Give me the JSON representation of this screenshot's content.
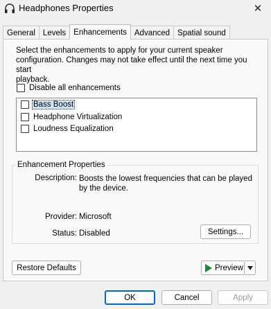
{
  "window": {
    "title": "Headphones Properties",
    "close_glyph": "✕"
  },
  "tabs": [
    {
      "label": "General",
      "active": false
    },
    {
      "label": "Levels",
      "active": false
    },
    {
      "label": "Enhancements",
      "active": true
    },
    {
      "label": "Advanced",
      "active": false
    },
    {
      "label": "Spatial sound",
      "active": false
    }
  ],
  "enhancements": {
    "description_line1": "Select the enhancements to apply for your current speaker",
    "description_line2": "configuration. Changes may not take effect until the next time you start",
    "description_line3": "playback.",
    "disable_all_label": "Disable all enhancements",
    "disable_all_checked": false,
    "items": [
      {
        "label": "Bass Boost",
        "checked": false,
        "selected": true
      },
      {
        "label": "Headphone Virtualization",
        "checked": false,
        "selected": false
      },
      {
        "label": "Loudness Equalization",
        "checked": false,
        "selected": false
      }
    ]
  },
  "properties": {
    "group_title": "Enhancement Properties",
    "description_label": "Description:",
    "description_line1": "Boosts the lowest frequencies that can be played",
    "description_line2": "by the device.",
    "provider_label": "Provider:",
    "provider_value": "Microsoft",
    "status_label": "Status:",
    "status_value": "Disabled",
    "settings_button": "Settings..."
  },
  "actions": {
    "restore_defaults": "Restore Defaults",
    "preview": "Preview"
  },
  "dialog_buttons": {
    "ok": "OK",
    "cancel": "Cancel",
    "apply": "Apply",
    "apply_enabled": false
  }
}
